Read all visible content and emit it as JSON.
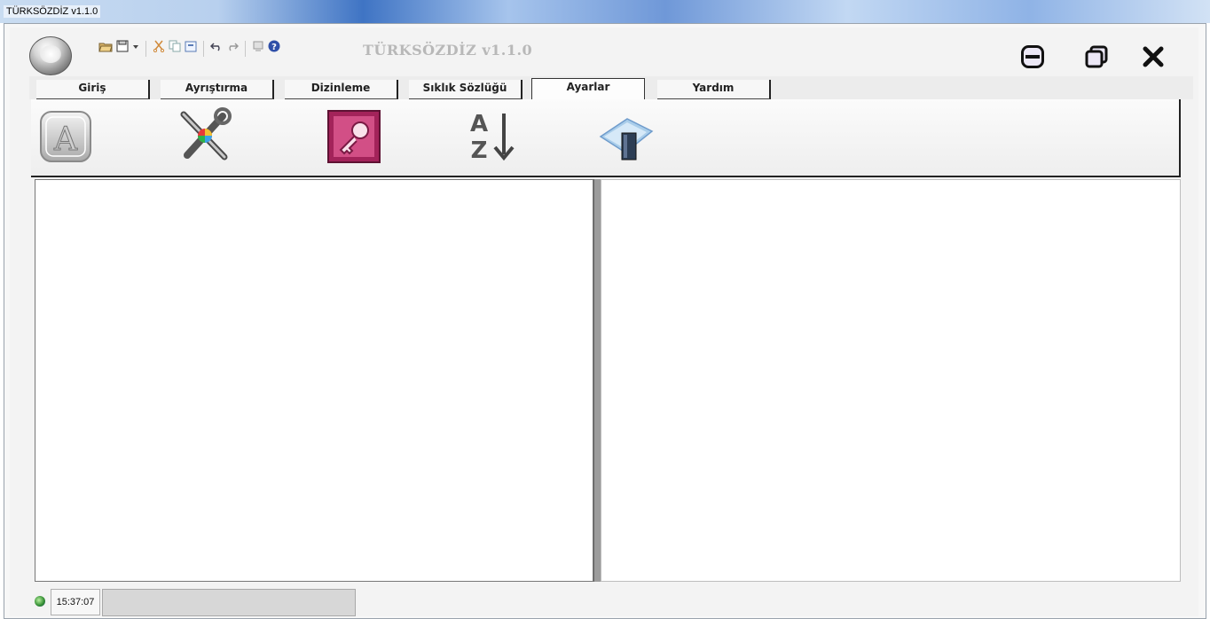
{
  "window": {
    "title": "TÜRKSÖZDİZ v1.1.0"
  },
  "app": {
    "title": "TÜRKSÖZDİZ v1.1.0"
  },
  "quick_access": [
    {
      "icon": "open-folder-icon"
    },
    {
      "icon": "save-icon"
    },
    {
      "icon": "dropdown-arrow-icon"
    },
    {
      "icon": "cut-icon"
    },
    {
      "icon": "copy-icon"
    },
    {
      "icon": "paste-icon"
    },
    {
      "icon": "undo-icon"
    },
    {
      "icon": "redo-icon"
    },
    {
      "icon": "stamp-icon"
    },
    {
      "icon": "help-icon"
    }
  ],
  "window_controls": [
    {
      "icon": "minimize-icon"
    },
    {
      "icon": "maximize-icon"
    },
    {
      "icon": "close-icon"
    }
  ],
  "tabs": [
    {
      "label": "Giriş",
      "active": false
    },
    {
      "label": "Ayrıştırma",
      "active": false
    },
    {
      "label": "Dizinleme",
      "active": false
    },
    {
      "label": "Sıklık Sözlüğü",
      "active": false
    },
    {
      "label": "Ayarlar",
      "active": true
    },
    {
      "label": "Yardım",
      "active": false
    }
  ],
  "ribbon": [
    {
      "icon": "font-icon"
    },
    {
      "icon": "tools-icon"
    },
    {
      "icon": "access-key-icon"
    },
    {
      "icon": "sort-az-icon"
    },
    {
      "icon": "book-icon"
    }
  ],
  "status": {
    "time": "15:37:07",
    "icon": "network-icon"
  },
  "colors": {
    "accent": "#3f74c4",
    "close": "#000000",
    "splitter": "#9c9c9c"
  }
}
